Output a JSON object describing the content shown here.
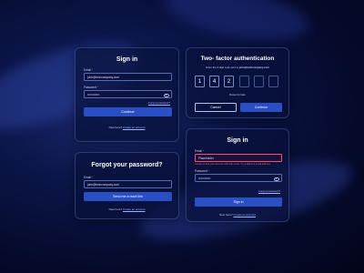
{
  "signin_top": {
    "title": "Sign in",
    "email_label": "Email",
    "email_value": "john@techcompany.com",
    "password_label": "Password",
    "password_value": "••••••••••••",
    "forgot_link": "Forgot password?",
    "continue_label": "Continue",
    "new_here": "New here?",
    "create_account": "Create an account"
  },
  "forgot": {
    "title": "Forgot your password?",
    "email_label": "Email",
    "email_value": "john@techcompany.com",
    "send_label": "Send me a reset link",
    "new_here": "New here?",
    "create_account": "Create an account"
  },
  "two_factor": {
    "title": "Two- factor authentication",
    "subtitle_prefix": "Enter the 6-digit code sent to",
    "subtitle_email": "john@techcompany.com",
    "digits": [
      "1",
      "4",
      "2",
      "",
      "",
      ""
    ],
    "resend": "Resend code",
    "cancel_label": "Cancel",
    "continue_label": "Continue"
  },
  "signin_error": {
    "title": "Sign in",
    "email_label": "Email",
    "email_value": "Placeholder",
    "error_text": "Could not find your account with that email. Try a different email address.",
    "password_label": "Password",
    "password_value": "••••••••••••",
    "forgot_link": "Forgot password?",
    "signin_label": "Sign in",
    "new_here": "New here?",
    "create_account": "Create an account"
  },
  "colors": {
    "accent": "#2a4fc4",
    "error": "#ff4d6d",
    "background": "#0b1447"
  }
}
